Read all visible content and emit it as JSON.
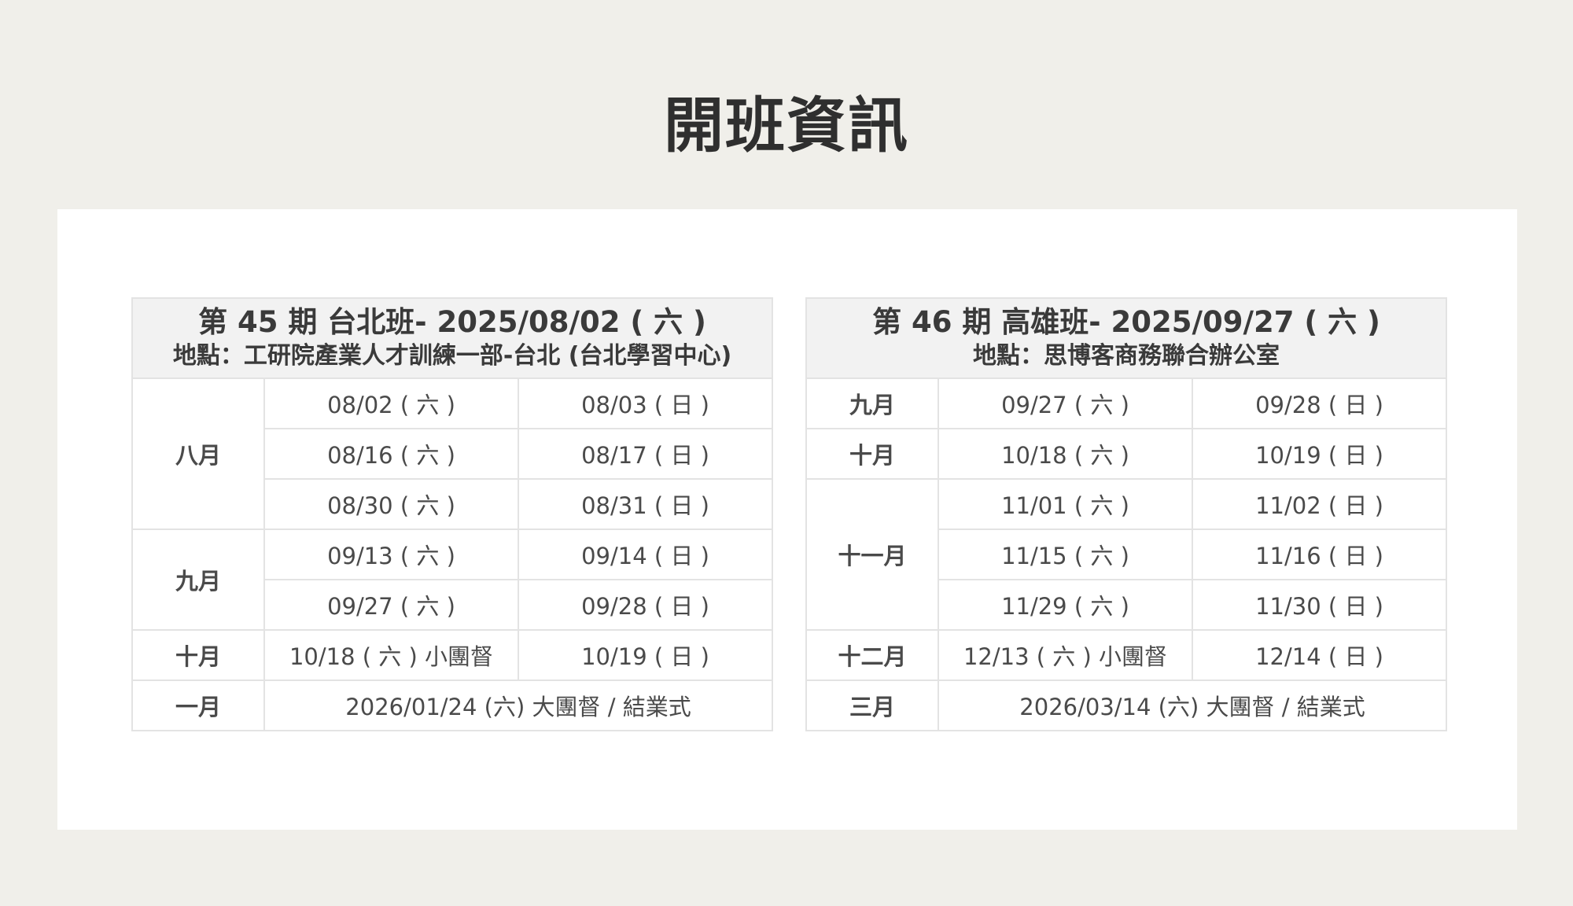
{
  "title": "開班資訊",
  "schedules": [
    {
      "header_line1": "第 45 期 台北班- 2025/08/02 ( 六 )",
      "header_line2": "地點：工研院產業人才訓練一部-台北 (台北學習中心)",
      "months": {
        "m1": "八月",
        "m2": "九月",
        "m3": "十月",
        "m4": "一月"
      },
      "dates": {
        "r1a": "08/02 ( 六 )",
        "r1b": "08/03 ( 日 )",
        "r2a": "08/16 ( 六 )",
        "r2b": "08/17 ( 日 )",
        "r3a": "08/30 ( 六 )",
        "r3b": "08/31 ( 日 )",
        "r4a": "09/13 ( 六 )",
        "r4b": "09/14 ( 日 )",
        "r5a": "09/27 ( 六 )",
        "r5b": "09/28 ( 日 )",
        "r6a": "10/18 ( 六 ) 小團督",
        "r6b": "10/19 ( 日 )",
        "r7": "2026/01/24 (六) 大團督 / 結業式"
      }
    },
    {
      "header_line1": "第 46 期 高雄班- 2025/09/27 ( 六 )",
      "header_line2": "地點：思博客商務聯合辦公室",
      "months": {
        "m1": "九月",
        "m2": "十月",
        "m3": "十一月",
        "m4": "十二月",
        "m5": "三月"
      },
      "dates": {
        "r1a": "09/27 ( 六 )",
        "r1b": "09/28 ( 日 )",
        "r2a": "10/18 ( 六 )",
        "r2b": "10/19 ( 日 )",
        "r3a": "11/01 ( 六 )",
        "r3b": "11/02 ( 日 )",
        "r4a": "11/15 ( 六 )",
        "r4b": "11/16 ( 日 )",
        "r5a": "11/29 ( 六 )",
        "r5b": "11/30 ( 日 )",
        "r6a": "12/13 ( 六 ) 小團督",
        "r6b": "12/14 ( 日 )",
        "r7": "2026/03/14 (六) 大團督 / 結業式"
      }
    }
  ]
}
